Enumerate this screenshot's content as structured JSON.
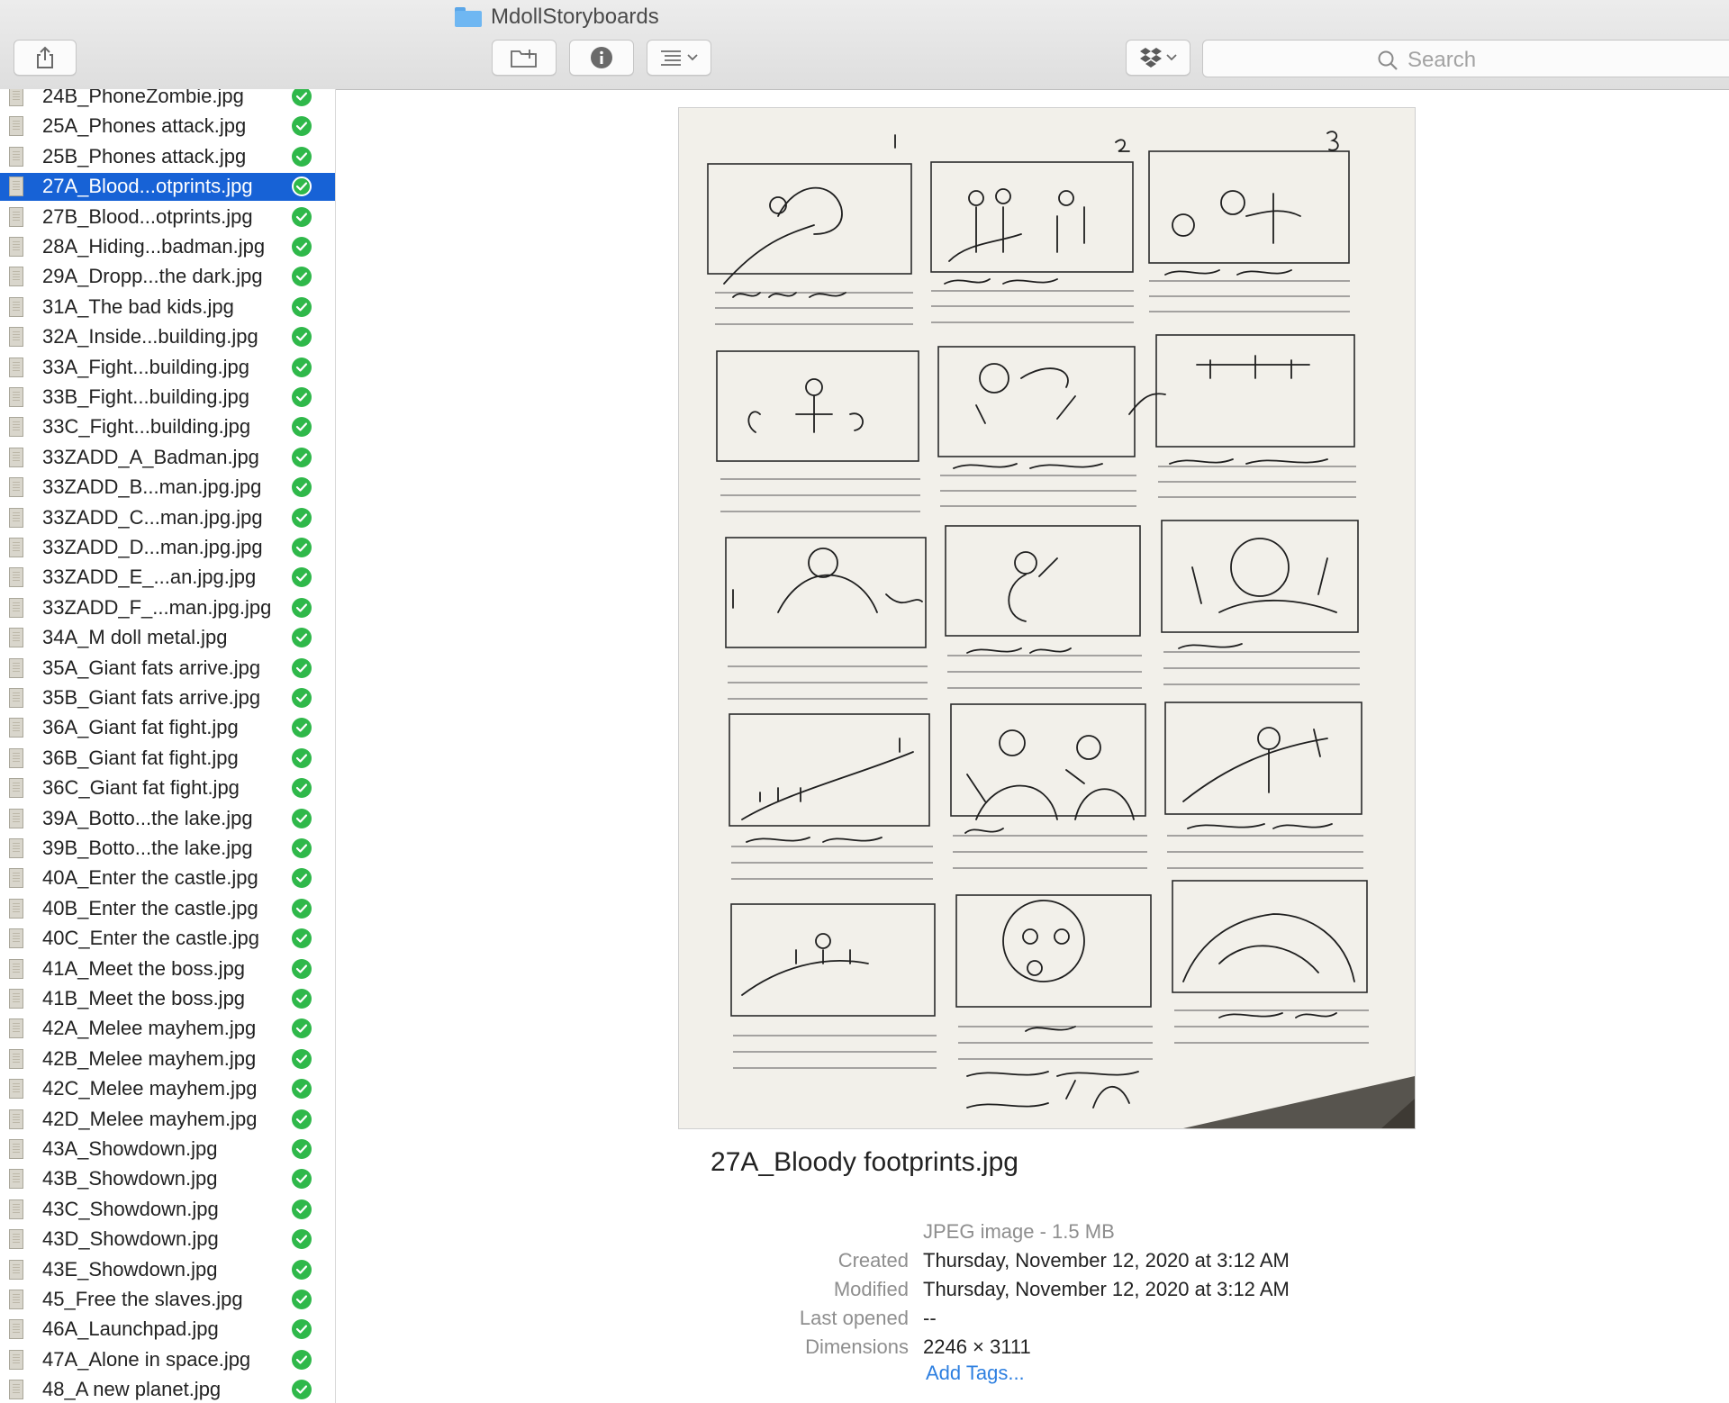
{
  "window": {
    "title": "MdollStoryboards"
  },
  "toolbar": {
    "share_icon": "share-icon",
    "new_folder_icon": "new-folder-icon",
    "info_icon": "info-icon",
    "view_icon": "list-view-icon",
    "dropbox_icon": "dropbox-icon",
    "search_placeholder": "Search"
  },
  "colors": {
    "selection": "#1762d6",
    "sync_check": "#2fb84a",
    "link": "#2d7fe0"
  },
  "files": [
    {
      "name": "24B_PhoneZombie.jpg"
    },
    {
      "name": "25A_Phones attack.jpg"
    },
    {
      "name": "25B_Phones attack.jpg"
    },
    {
      "name": "27A_Blood...otprints.jpg",
      "selected": true
    },
    {
      "name": "27B_Blood...otprints.jpg"
    },
    {
      "name": "28A_Hiding...badman.jpg"
    },
    {
      "name": "29A_Dropp...the dark.jpg"
    },
    {
      "name": "31A_The bad kids.jpg"
    },
    {
      "name": "32A_Inside...building.jpg"
    },
    {
      "name": "33A_Fight...building.jpg"
    },
    {
      "name": "33B_Fight...building.jpg"
    },
    {
      "name": "33C_Fight...building.jpg"
    },
    {
      "name": "33ZADD_A_Badman.jpg"
    },
    {
      "name": "33ZADD_B...man.jpg.jpg"
    },
    {
      "name": "33ZADD_C...man.jpg.jpg"
    },
    {
      "name": "33ZADD_D...man.jpg.jpg"
    },
    {
      "name": "33ZADD_E_...an.jpg.jpg"
    },
    {
      "name": "33ZADD_F_...man.jpg.jpg"
    },
    {
      "name": "34A_M doll metal.jpg"
    },
    {
      "name": "35A_Giant fats arrive.jpg"
    },
    {
      "name": "35B_Giant fats arrive.jpg"
    },
    {
      "name": "36A_Giant fat fight.jpg"
    },
    {
      "name": "36B_Giant fat fight.jpg"
    },
    {
      "name": "36C_Giant fat fight.jpg"
    },
    {
      "name": "39A_Botto...the lake.jpg"
    },
    {
      "name": "39B_Botto...the lake.jpg"
    },
    {
      "name": "40A_Enter the castle.jpg"
    },
    {
      "name": "40B_Enter the castle.jpg"
    },
    {
      "name": "40C_Enter the castle.jpg"
    },
    {
      "name": "41A_Meet the boss.jpg"
    },
    {
      "name": "41B_Meet the boss.jpg"
    },
    {
      "name": "42A_Melee mayhem.jpg"
    },
    {
      "name": "42B_Melee mayhem.jpg"
    },
    {
      "name": "42C_Melee mayhem.jpg"
    },
    {
      "name": "42D_Melee mayhem.jpg"
    },
    {
      "name": "43A_Showdown.jpg"
    },
    {
      "name": "43B_Showdown.jpg"
    },
    {
      "name": "43C_Showdown.jpg"
    },
    {
      "name": "43D_Showdown.jpg"
    },
    {
      "name": "43E_Showdown.jpg"
    },
    {
      "name": "45_Free the slaves.jpg"
    },
    {
      "name": "46A_Launchpad.jpg"
    },
    {
      "name": "47A_Alone in space.jpg"
    },
    {
      "name": "48_A new planet.jpg"
    }
  ],
  "preview": {
    "file_name": "27A_Bloody footprints.jpg",
    "kind": "JPEG image - 1.5 MB",
    "created_label": "Created",
    "created_value": "Thursday, November 12, 2020 at 3:12 AM",
    "modified_label": "Modified",
    "modified_value": "Thursday, November 12, 2020 at 3:12 AM",
    "last_opened_label": "Last opened",
    "last_opened_value": "--",
    "dimensions_label": "Dimensions",
    "dimensions_value": "2246 × 3111",
    "add_tags": "Add Tags..."
  }
}
